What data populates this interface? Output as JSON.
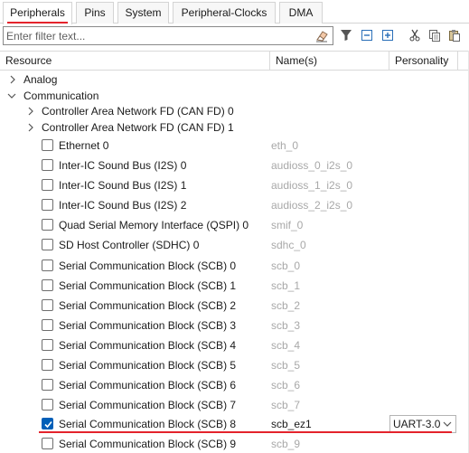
{
  "tabs": [
    {
      "label": "Peripherals",
      "active": true
    },
    {
      "label": "Pins"
    },
    {
      "label": "System"
    },
    {
      "label": "Peripheral-Clocks"
    },
    {
      "label": "DMA"
    }
  ],
  "filter": {
    "placeholder": "Enter filter text..."
  },
  "toolbar_icons": [
    "eraser-icon",
    "filter-icon",
    "collapse-all-icon",
    "expand-all-icon",
    "cut-icon",
    "copy-icon",
    "paste-icon"
  ],
  "columns": {
    "resource": "Resource",
    "names": "Name(s)",
    "personality": "Personality"
  },
  "tree": [
    {
      "label": "Analog",
      "level": 0,
      "expander": "collapsed"
    },
    {
      "label": "Communication",
      "level": 0,
      "expander": "expanded"
    },
    {
      "label": "Controller Area Network FD (CAN FD) 0",
      "level": 1,
      "expander": "collapsed"
    },
    {
      "label": "Controller Area Network FD (CAN FD) 1",
      "level": 1,
      "expander": "collapsed"
    },
    {
      "label": "Ethernet 0",
      "level": 2,
      "checked": false,
      "alias": "eth_0"
    },
    {
      "label": "Inter-IC Sound Bus (I2S) 0",
      "level": 2,
      "checked": false,
      "alias": "audioss_0_i2s_0"
    },
    {
      "label": "Inter-IC Sound Bus (I2S) 1",
      "level": 2,
      "checked": false,
      "alias": "audioss_1_i2s_0"
    },
    {
      "label": "Inter-IC Sound Bus (I2S) 2",
      "level": 2,
      "checked": false,
      "alias": "audioss_2_i2s_0"
    },
    {
      "label": "Quad Serial Memory Interface (QSPI) 0",
      "level": 2,
      "checked": false,
      "alias": "smif_0"
    },
    {
      "label": "SD Host Controller (SDHC) 0",
      "level": 2,
      "checked": false,
      "alias": "sdhc_0"
    },
    {
      "label": "Serial Communication Block (SCB) 0",
      "level": 2,
      "checked": false,
      "alias": "scb_0"
    },
    {
      "label": "Serial Communication Block (SCB) 1",
      "level": 2,
      "checked": false,
      "alias": "scb_1"
    },
    {
      "label": "Serial Communication Block (SCB) 2",
      "level": 2,
      "checked": false,
      "alias": "scb_2"
    },
    {
      "label": "Serial Communication Block (SCB) 3",
      "level": 2,
      "checked": false,
      "alias": "scb_3"
    },
    {
      "label": "Serial Communication Block (SCB) 4",
      "level": 2,
      "checked": false,
      "alias": "scb_4"
    },
    {
      "label": "Serial Communication Block (SCB) 5",
      "level": 2,
      "checked": false,
      "alias": "scb_5"
    },
    {
      "label": "Serial Communication Block (SCB) 6",
      "level": 2,
      "checked": false,
      "alias": "scb_6"
    },
    {
      "label": "Serial Communication Block (SCB) 7",
      "level": 2,
      "checked": false,
      "alias": "scb_7"
    },
    {
      "label": "Serial Communication Block (SCB) 8",
      "level": 2,
      "checked": true,
      "alias": "scb_ez1",
      "personality": "UART-3.0"
    },
    {
      "label": "Serial Communication Block (SCB) 9",
      "level": 2,
      "checked": false,
      "alias": "scb_9"
    }
  ],
  "colors": {
    "accent_red": "#e4232c",
    "checkbox_blue": "#005fb8",
    "muted_text": "#a8a8a8"
  }
}
